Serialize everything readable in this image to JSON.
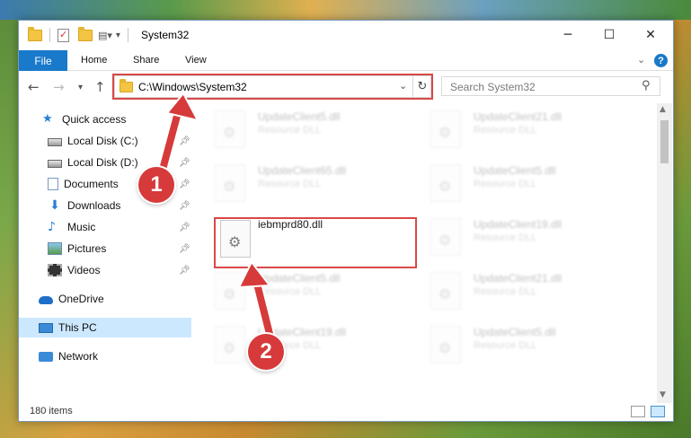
{
  "window": {
    "title": "System32",
    "controls": {
      "minimize": "─",
      "maximize": "☐",
      "close": "✕"
    }
  },
  "ribbon": {
    "tabs": [
      "File",
      "Home",
      "Share",
      "View"
    ],
    "collapse_icon": "chevron-down-icon",
    "help_label": "?"
  },
  "address": {
    "path": "C:\\Windows\\System32",
    "search_placeholder": "Search System32"
  },
  "nav": {
    "items": [
      {
        "label": "Quick access",
        "icon": "star-icon"
      },
      {
        "label": "Local Disk (C:)",
        "icon": "disk-icon",
        "pinned": true
      },
      {
        "label": "Local Disk (D:)",
        "icon": "disk-icon",
        "pinned": true
      },
      {
        "label": "Documents",
        "icon": "documents-icon",
        "pinned": true
      },
      {
        "label": "Downloads",
        "icon": "downloads-icon",
        "pinned": true
      },
      {
        "label": "Music",
        "icon": "music-icon",
        "pinned": true
      },
      {
        "label": "Pictures",
        "icon": "pictures-icon",
        "pinned": true
      },
      {
        "label": "Videos",
        "icon": "videos-icon",
        "pinned": true
      },
      {
        "label": "OneDrive",
        "icon": "onedrive-icon"
      },
      {
        "label": "This PC",
        "icon": "this-pc-icon",
        "selected": true
      },
      {
        "label": "Network",
        "icon": "network-icon"
      }
    ]
  },
  "files": {
    "highlighted": {
      "name": "iebmprd80.dll"
    },
    "background": [
      {
        "name": "UpdateClient5.dll",
        "type": "Resource DLL"
      },
      {
        "name": "UpdateClient21.dll",
        "type": "Resource DLL"
      },
      {
        "name": "UpdateClient65.dll",
        "type": "Resource DLL"
      },
      {
        "name": "UpdateClient5.dll",
        "type": "Resource DLL"
      },
      {
        "name": "UpdateClient19.dll",
        "type": "Resource DLL"
      },
      {
        "name": "UpdateClient5.dll",
        "type": "Resource DLL"
      },
      {
        "name": "UpdateClient21.dll",
        "type": "Resource DLL"
      },
      {
        "name": "UpdateClient19.dll",
        "type": "Resource DLL"
      },
      {
        "name": "UpdateClient5.dll",
        "type": "Resource DLL"
      }
    ]
  },
  "status": {
    "item_count": "180 items"
  },
  "annotations": {
    "step1": "1",
    "step2": "2",
    "color": "#d94848"
  }
}
